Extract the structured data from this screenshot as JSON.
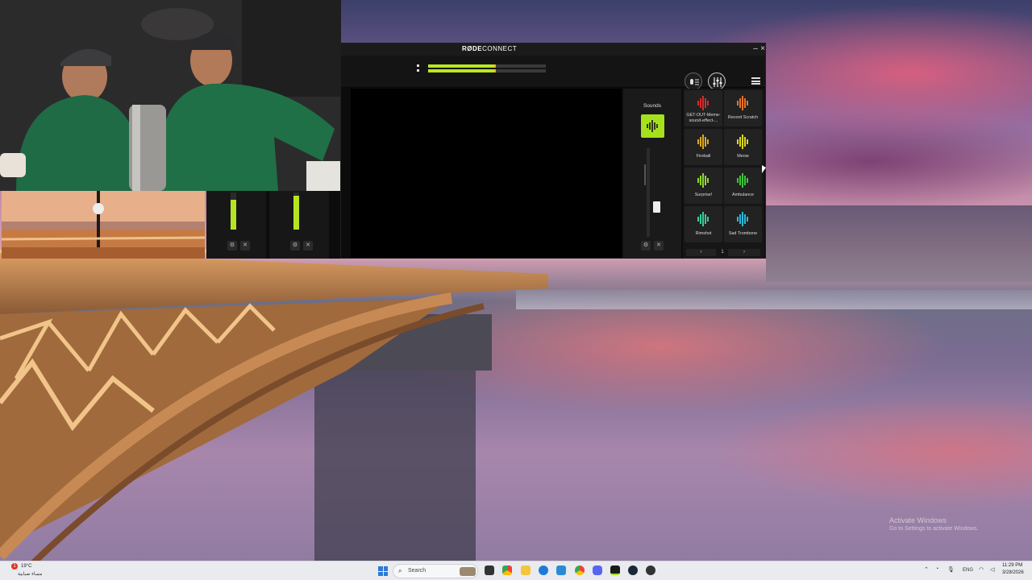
{
  "rode_window": {
    "logo_bold": "RØDE",
    "logo_light": "CONNECT",
    "minimize": "–",
    "close": "×"
  },
  "sounds": {
    "title": "Sounds",
    "pads": [
      {
        "label": "GET-OUT-Meme-sound-effect-...",
        "color": "#d62a2a",
        "icon": "waveform-icon"
      },
      {
        "label": "Record Scratch",
        "color": "#e8722a",
        "icon": "waveform-icon"
      },
      {
        "label": "Fireball",
        "color": "#e0a81e",
        "icon": "waveform-icon"
      },
      {
        "label": "Meow",
        "color": "#d9d61e",
        "icon": "waveform-icon"
      },
      {
        "label": "Surprise!",
        "color": "#8fd62a",
        "icon": "waveform-icon"
      },
      {
        "label": "Ambulance",
        "color": "#3ec43a",
        "icon": "waveform-icon"
      },
      {
        "label": "Rimshot",
        "color": "#36cc9a",
        "icon": "waveform-icon"
      },
      {
        "label": "Sad Trombone",
        "color": "#2ab8d6",
        "icon": "waveform-icon"
      }
    ],
    "page": "1",
    "prev": "‹",
    "next": "›"
  },
  "taskbar": {
    "weather_temp": "19°C",
    "weather_desc": "مساء ضبابية",
    "weather_badge": "1",
    "search_placeholder": "Search",
    "lang": "ENG",
    "time": "11:29 PM",
    "date": "3/28/2026"
  },
  "watermark": {
    "line1": "Activate Windows",
    "line2": "Go to Settings to activate Windows."
  },
  "colors": {
    "accent_green": "#a6e11d",
    "meter_green": "#b9e820",
    "peak_orange": "#f2b410"
  }
}
